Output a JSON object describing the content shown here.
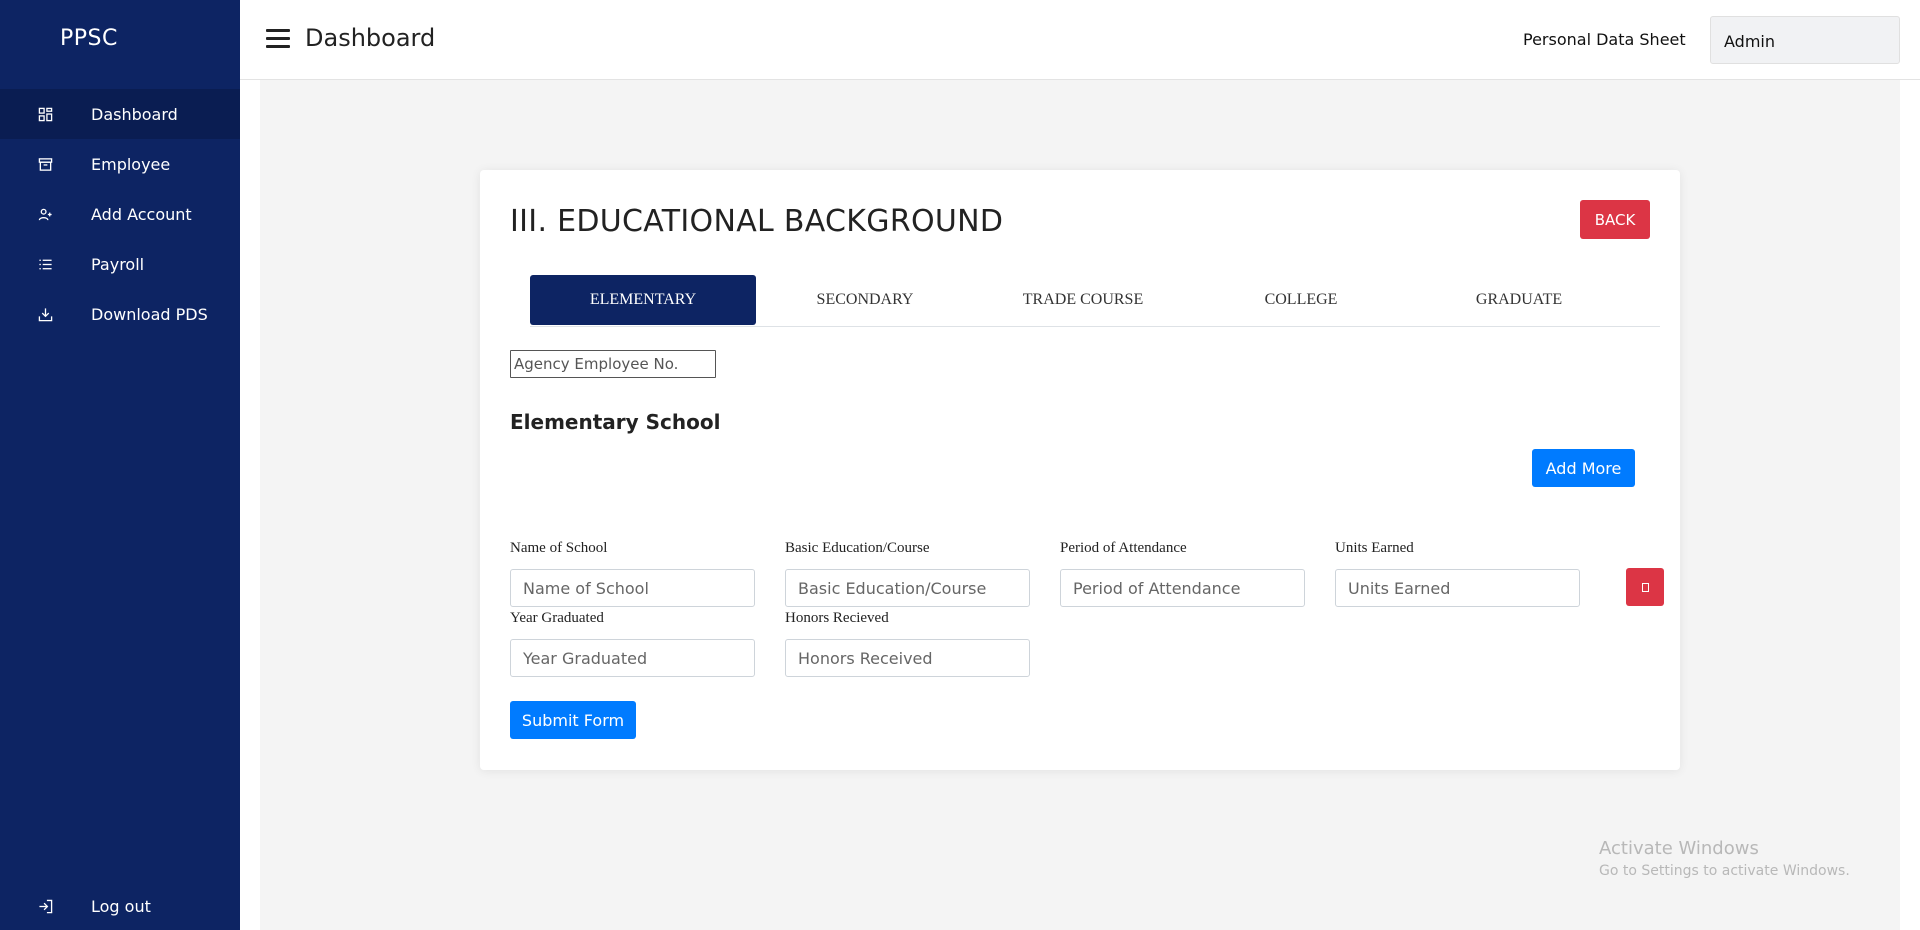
{
  "sidebar": {
    "brand": "PPSC",
    "items": [
      {
        "label": "Dashboard",
        "icon": "dashboard-grid-icon"
      },
      {
        "label": "Employee",
        "icon": "archive-icon"
      },
      {
        "label": "Add Account",
        "icon": "user-plus-icon"
      },
      {
        "label": "Payroll",
        "icon": "list-icon"
      },
      {
        "label": "Download PDS",
        "icon": "download-icon"
      }
    ],
    "logout": {
      "label": "Log out",
      "icon": "logout-icon"
    }
  },
  "topbar": {
    "title": "Dashboard",
    "pds_link": "Personal Data Sheet",
    "user": "Admin"
  },
  "card": {
    "title": "III. EDUCATIONAL BACKGROUND",
    "back_label": "BACK",
    "tabs": [
      "ELEMENTARY",
      "SECONDARY",
      "TRADE COURSE",
      "COLLEGE",
      "GRADUATE"
    ],
    "active_tab": "ELEMENTARY",
    "agency_placeholder": "Agency Employee No.",
    "section_title": "Elementary School",
    "add_more_label": "Add More",
    "fields": {
      "school": {
        "label": "Name of School",
        "placeholder": "Name of School"
      },
      "course": {
        "label": "Basic Education/Course",
        "placeholder": "Basic Education/Course"
      },
      "period": {
        "label": "Period of Attendance",
        "placeholder": "Period of Attendance"
      },
      "units": {
        "label": "Units Earned",
        "placeholder": "Units Earned"
      },
      "year": {
        "label": "Year Graduated",
        "placeholder": "Year Graduated"
      },
      "honors": {
        "label": "Honors Recieved",
        "placeholder": "Honors Received"
      }
    },
    "submit_label": "Submit Form"
  },
  "watermark": {
    "line1": "Activate Windows",
    "line2": "Go to Settings to activate Windows."
  },
  "colors": {
    "sidebar": "#0d2463",
    "primary": "#007bff",
    "danger": "#dc3545"
  }
}
